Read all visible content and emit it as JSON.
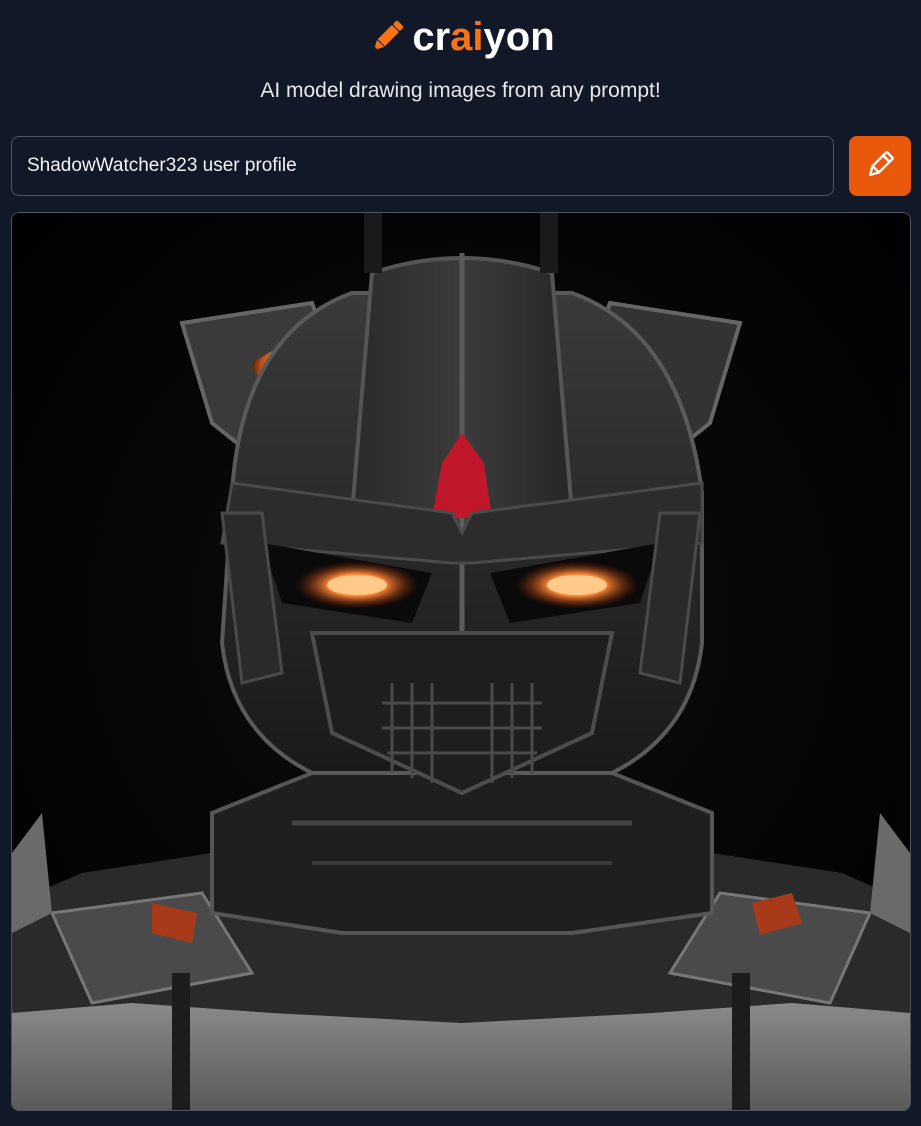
{
  "header": {
    "logo_icon": "pencil-icon",
    "logo_part1": "cr",
    "logo_part2": "ai",
    "logo_part3": "yon",
    "accent_color": "#f97316"
  },
  "tagline": "AI model drawing images from any prompt!",
  "prompt": {
    "value": "ShadowWatcher323 user profile",
    "button_icon": "pencil-icon",
    "button_color": "#ea580c"
  },
  "generated_image": {
    "subject": "dark armored robot helmet with glowing orange eyes"
  }
}
